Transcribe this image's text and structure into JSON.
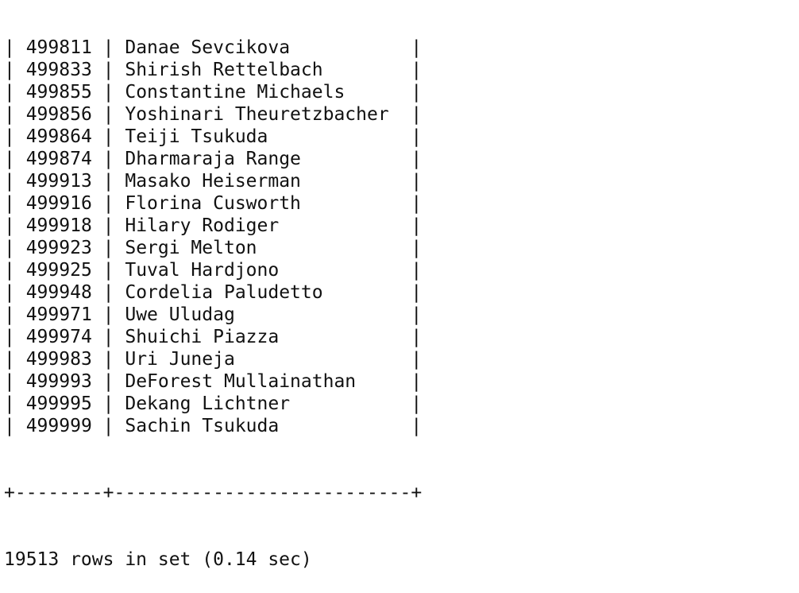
{
  "table": {
    "rows": [
      {
        "id": "499811",
        "name": "Danae Sevcikova"
      },
      {
        "id": "499833",
        "name": "Shirish Rettelbach"
      },
      {
        "id": "499855",
        "name": "Constantine Michaels"
      },
      {
        "id": "499856",
        "name": "Yoshinari Theuretzbacher"
      },
      {
        "id": "499864",
        "name": "Teiji Tsukuda"
      },
      {
        "id": "499874",
        "name": "Dharmaraja Range"
      },
      {
        "id": "499913",
        "name": "Masako Heiserman"
      },
      {
        "id": "499916",
        "name": "Florina Cusworth"
      },
      {
        "id": "499918",
        "name": "Hilary Rodiger"
      },
      {
        "id": "499923",
        "name": "Sergi Melton"
      },
      {
        "id": "499925",
        "name": "Tuval Hardjono"
      },
      {
        "id": "499948",
        "name": "Cordelia Paludetto"
      },
      {
        "id": "499971",
        "name": "Uwe Uludag"
      },
      {
        "id": "499974",
        "name": "Shuichi Piazza"
      },
      {
        "id": "499983",
        "name": "Uri Juneja"
      },
      {
        "id": "499993",
        "name": "DeForest Mullainathan"
      },
      {
        "id": "499995",
        "name": "Dekang Lichtner"
      },
      {
        "id": "499999",
        "name": "Sachin Tsukuda"
      }
    ],
    "bottom_border": "+--------+---------------------------+"
  },
  "status": {
    "result_text": "19513 rows in set (0.14 sec)"
  }
}
